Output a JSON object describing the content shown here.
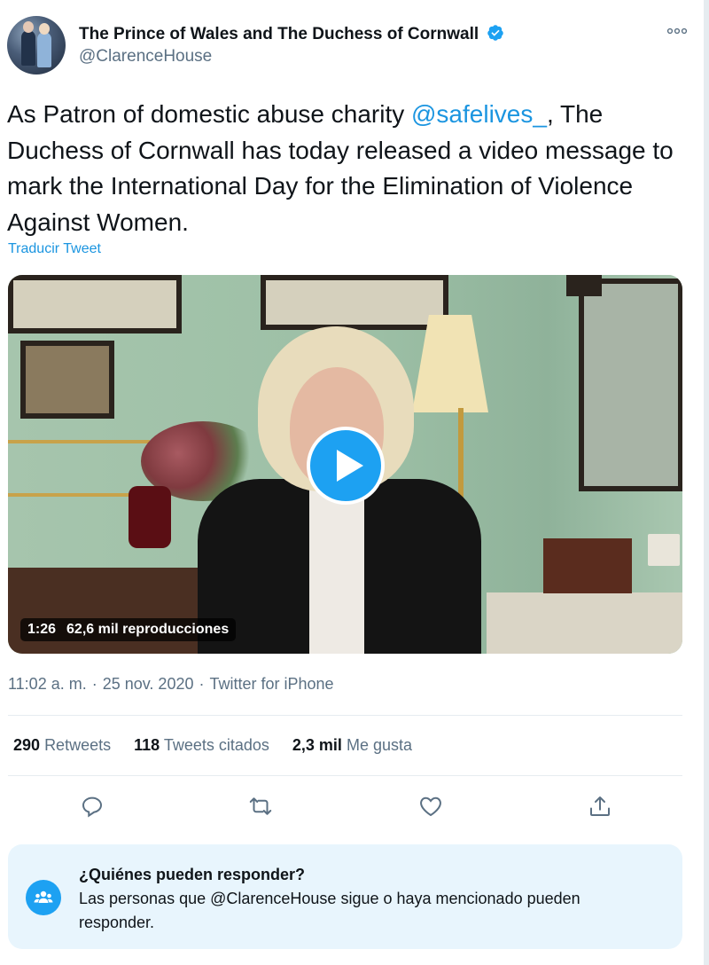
{
  "tweet": {
    "author": {
      "display_name": "The Prince of Wales and The Duchess of Cornwall",
      "handle": "@ClarenceHouse",
      "verified": true
    },
    "text": {
      "before_mention": "As Patron of domestic abuse charity ",
      "mention": "@safelives_",
      "after_mention": ", The Duchess of Cornwall has today released a video message to mark the International Day for the Elimination of Violence Against Women."
    },
    "translate_label": "Traducir Tweet",
    "video": {
      "duration": "1:26",
      "views": "62,6 mil reproducciones"
    },
    "meta": {
      "time": "11:02 a. m.",
      "separator": "·",
      "date": "25 nov. 2020",
      "source": "Twitter for iPhone"
    },
    "stats": {
      "retweets_count": "290",
      "retweets_label": "Retweets",
      "quotes_count": "118",
      "quotes_label": "Tweets citados",
      "likes_count": "2,3 mil",
      "likes_label": "Me gusta"
    }
  },
  "reply_restriction": {
    "title": "¿Quiénes pueden responder?",
    "description": "Las personas que @ClarenceHouse sigue o haya mencionado pueden responder."
  },
  "icons": [
    "more-icon",
    "verified-icon",
    "play-icon",
    "reply-icon",
    "retweet-icon",
    "like-icon",
    "share-icon",
    "people-icon"
  ],
  "colors": {
    "accent": "#1da1f2",
    "link": "#1b95e0",
    "secondary_text": "#5b7083",
    "notice_background": "#e8f5fd"
  }
}
